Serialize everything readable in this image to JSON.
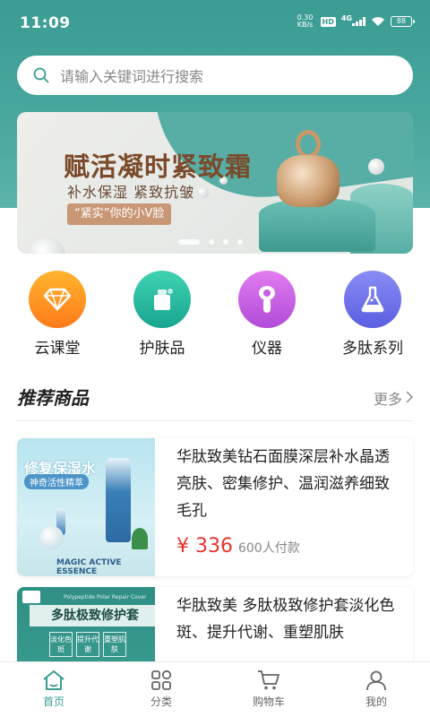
{
  "status_bar": {
    "time": "11:09",
    "net_speed_value": "0.30",
    "net_speed_unit": "KB/s",
    "hd": "HD",
    "network": "4G",
    "battery": "88"
  },
  "search": {
    "placeholder": "请输入关键词进行搜索"
  },
  "banner": {
    "title": "赋活凝时紧致霜",
    "subtitle": "补水保湿  紧致抗皱",
    "tag": "“紧实”你的小V脸",
    "slide_count": 4,
    "active_slide": 1
  },
  "categories": [
    {
      "label": "云课堂",
      "icon": "diamond-icon",
      "color_from": "#ffb52e",
      "color_to": "#ff7a1a"
    },
    {
      "label": "护肤品",
      "icon": "cream-bottle-icon",
      "color_from": "#3fd3b2",
      "color_to": "#18a58f"
    },
    {
      "label": "仪器",
      "icon": "beauty-device-icon",
      "color_from": "#e27cf0",
      "color_to": "#b04bd8"
    },
    {
      "label": "多肽系列",
      "icon": "flask-icon",
      "color_from": "#8a8cf5",
      "color_to": "#5a5ee0"
    }
  ],
  "section": {
    "title": "推荐商品",
    "more": "更多"
  },
  "products": [
    {
      "image_title": "修复保湿水",
      "image_badge": "神奇活性精萃",
      "image_caption": "MAGIC ACTIVE ESSENCE",
      "name": "华肽致美钻石面膜深层补水晶透亮肤、密集修护、温润滋养细致毛孔",
      "price": "¥ 336",
      "sold": "600人付款"
    },
    {
      "image_caption": "Polypeptide Polar Repair Cover",
      "image_title": "多肽极致修护套",
      "image_tags": [
        "淡化色斑",
        "提升代谢",
        "重塑肌肤"
      ],
      "name": "华肽致美 多肽极致修护套淡化色斑、提升代谢、重塑肌肤"
    }
  ],
  "tabbar": [
    {
      "label": "首页",
      "icon": "home-icon",
      "active": true
    },
    {
      "label": "分类",
      "icon": "category-grid-icon",
      "active": false
    },
    {
      "label": "购物车",
      "icon": "cart-icon",
      "active": false
    },
    {
      "label": "我的",
      "icon": "user-icon",
      "active": false
    }
  ],
  "colors": {
    "accent": "#3a9c93",
    "price": "#e8342e"
  }
}
